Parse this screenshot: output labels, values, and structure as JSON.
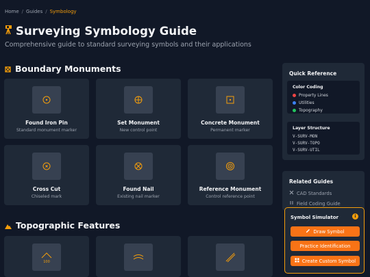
{
  "breadcrumb": {
    "home": "Home",
    "sep": "/",
    "guides": "Guides",
    "current": "Symbology"
  },
  "page": {
    "title": "Surveying Symbology Guide",
    "subtitle": "Comprehensive guide to standard surveying symbols and their applications"
  },
  "sections": {
    "boundary": "Boundary Monuments",
    "topographic": "Topographic Features"
  },
  "monuments": [
    {
      "name": "Found Iron Pin",
      "desc": "Standard monument marker",
      "icon": "circle-dot-icon"
    },
    {
      "name": "Set Monument",
      "desc": "New control point",
      "icon": "circle-cross-icon"
    },
    {
      "name": "Concrete Monument",
      "desc": "Permanent marker",
      "icon": "square-dot-icon"
    },
    {
      "name": "Cross Cut",
      "desc": "Chiseled mark",
      "icon": "circle-x-small-icon"
    },
    {
      "name": "Found Nail",
      "desc": "Existing nail marker",
      "icon": "circle-x-icon"
    },
    {
      "name": "Reference Monument",
      "desc": "Control reference point",
      "icon": "double-circle-icon"
    }
  ],
  "topo_icons": [
    {
      "icon": "triangle-elevation-icon",
      "label": "100"
    },
    {
      "icon": "arc-contour-icon"
    },
    {
      "icon": "diagonal-lines-icon"
    }
  ],
  "quick_reference": {
    "title": "Quick Reference",
    "color_coding": {
      "title": "Color Coding",
      "items": [
        {
          "label": "Property Lines",
          "color": "#ef4444"
        },
        {
          "label": "Utilities",
          "color": "#3b82f6"
        },
        {
          "label": "Topography",
          "color": "#22c55e"
        }
      ]
    },
    "layer_structure": {
      "title": "Layer Structure",
      "items": [
        "V-SURV-MON",
        "V-SURV-TOPO",
        "V-SURV-UTIL"
      ]
    }
  },
  "related_guides": {
    "title": "Related Guides",
    "items": [
      {
        "label": "CAD Standards",
        "icon": "tools-icon"
      },
      {
        "label": "Field Coding Guide",
        "icon": "field-code-icon"
      }
    ]
  },
  "simulator": {
    "title": "Symbol Simulator",
    "info": "i",
    "buttons": [
      "Draw Symbol",
      "Practice Identification",
      "Create Custom Symbol"
    ]
  },
  "colors": {
    "accent": "#f59e0b",
    "button": "#f97316",
    "bg": "#111827",
    "card": "#1f2937"
  }
}
